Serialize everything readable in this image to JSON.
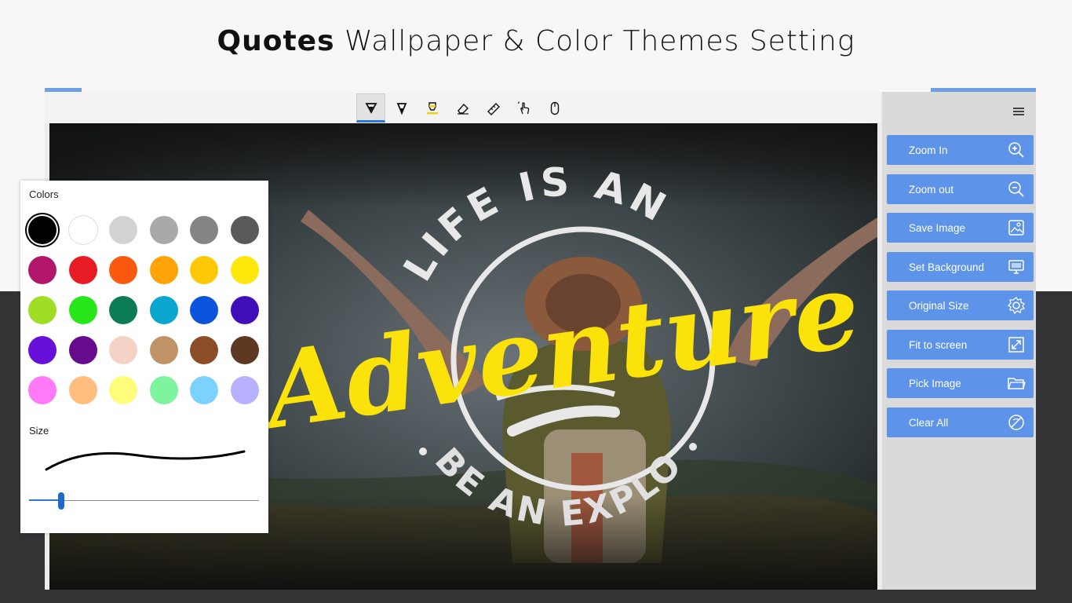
{
  "header": {
    "title_bold": "Quotes",
    "title_rest": "Wallpaper & Color Themes Setting"
  },
  "toolbar": {
    "tools": [
      {
        "icon": "ballpoint-pen-icon",
        "active": true
      },
      {
        "icon": "pencil-icon",
        "active": false
      },
      {
        "icon": "highlighter-icon",
        "active": false
      },
      {
        "icon": "eraser-icon",
        "active": false
      },
      {
        "icon": "ruler-icon",
        "active": false
      },
      {
        "icon": "touch-writing-icon",
        "active": false
      },
      {
        "icon": "mouse-icon",
        "active": false
      }
    ]
  },
  "canvas": {
    "quote_top": "LIFE IS AN",
    "quote_main": "Adventure",
    "quote_bottom": "BE AN EXPLORER"
  },
  "sidebar": {
    "menu_icon": "hamburger-menu-icon",
    "buttons": [
      {
        "label": "Zoom In",
        "icon": "zoom-in-icon"
      },
      {
        "label": "Zoom out",
        "icon": "zoom-out-icon"
      },
      {
        "label": "Save Image",
        "icon": "save-image-icon"
      },
      {
        "label": "Set Background",
        "icon": "monitor-icon"
      },
      {
        "label": "Original Size",
        "icon": "settings-gear-icon"
      },
      {
        "label": "Fit to screen",
        "icon": "fit-screen-icon"
      },
      {
        "label": "Pick Image",
        "icon": "folder-icon"
      },
      {
        "label": "Clear All",
        "icon": "clear-all-icon"
      }
    ]
  },
  "palette": {
    "colors_label": "Colors",
    "size_label": "Size",
    "selected_index": 0,
    "pen_size_fraction": 0.14,
    "colors": [
      "#000000",
      "#ffffff",
      "#d2d2d2",
      "#a9a9a9",
      "#858585",
      "#5a5a5a",
      "#b3176b",
      "#e81c25",
      "#fb5a0e",
      "#ffa30a",
      "#ffc806",
      "#ffe70b",
      "#9fdd26",
      "#27e619",
      "#0b7c55",
      "#0aa6cd",
      "#0a55dc",
      "#400fb8",
      "#6610d9",
      "#650b8c",
      "#f4d3c6",
      "#bf9365",
      "#8a4d27",
      "#5d3823",
      "#ff7af7",
      "#ffbe7e",
      "#fffc7b",
      "#7df49d",
      "#7cd2ff",
      "#b7b1ff"
    ]
  },
  "colors": {
    "accent": "#5d94ea",
    "slider": "#1d68c9",
    "quote_yellow": "#fbe20a"
  }
}
